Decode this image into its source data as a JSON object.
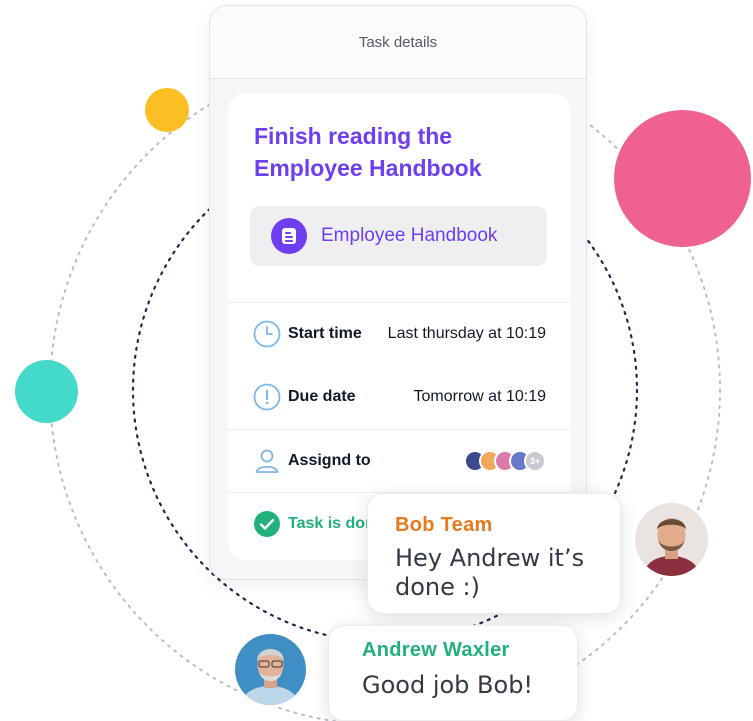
{
  "header": {
    "title": "Task details"
  },
  "task": {
    "title": "Finish reading the Employee Handbook",
    "document": {
      "icon": "document-icon",
      "label": "Employee Handbook"
    },
    "start": {
      "icon": "clock-icon",
      "label": "Start time",
      "value": "Last thursday at 10:19"
    },
    "due": {
      "icon": "exclamation-circle-icon",
      "label": "Due date",
      "value": "Tomorrow at 10:19"
    },
    "assign": {
      "icon": "user-icon",
      "label": "Assignd to",
      "more": "3+"
    },
    "done": {
      "icon": "check-circle-icon",
      "label": "Task is done"
    }
  },
  "chat": {
    "bob": {
      "name": "Bob Team",
      "message": "Hey Andrew it’s done :)",
      "name_color": "#e7791f"
    },
    "andrew": {
      "name": "Andrew Waxler",
      "message": "Good job Bob!",
      "name_color": "#22b07d"
    }
  },
  "colors": {
    "accent": "#6d3ff1",
    "success": "#22b07d",
    "decor_yellow": "#fbbf24",
    "decor_pink": "#ef6190",
    "decor_teal": "#43dacb"
  }
}
